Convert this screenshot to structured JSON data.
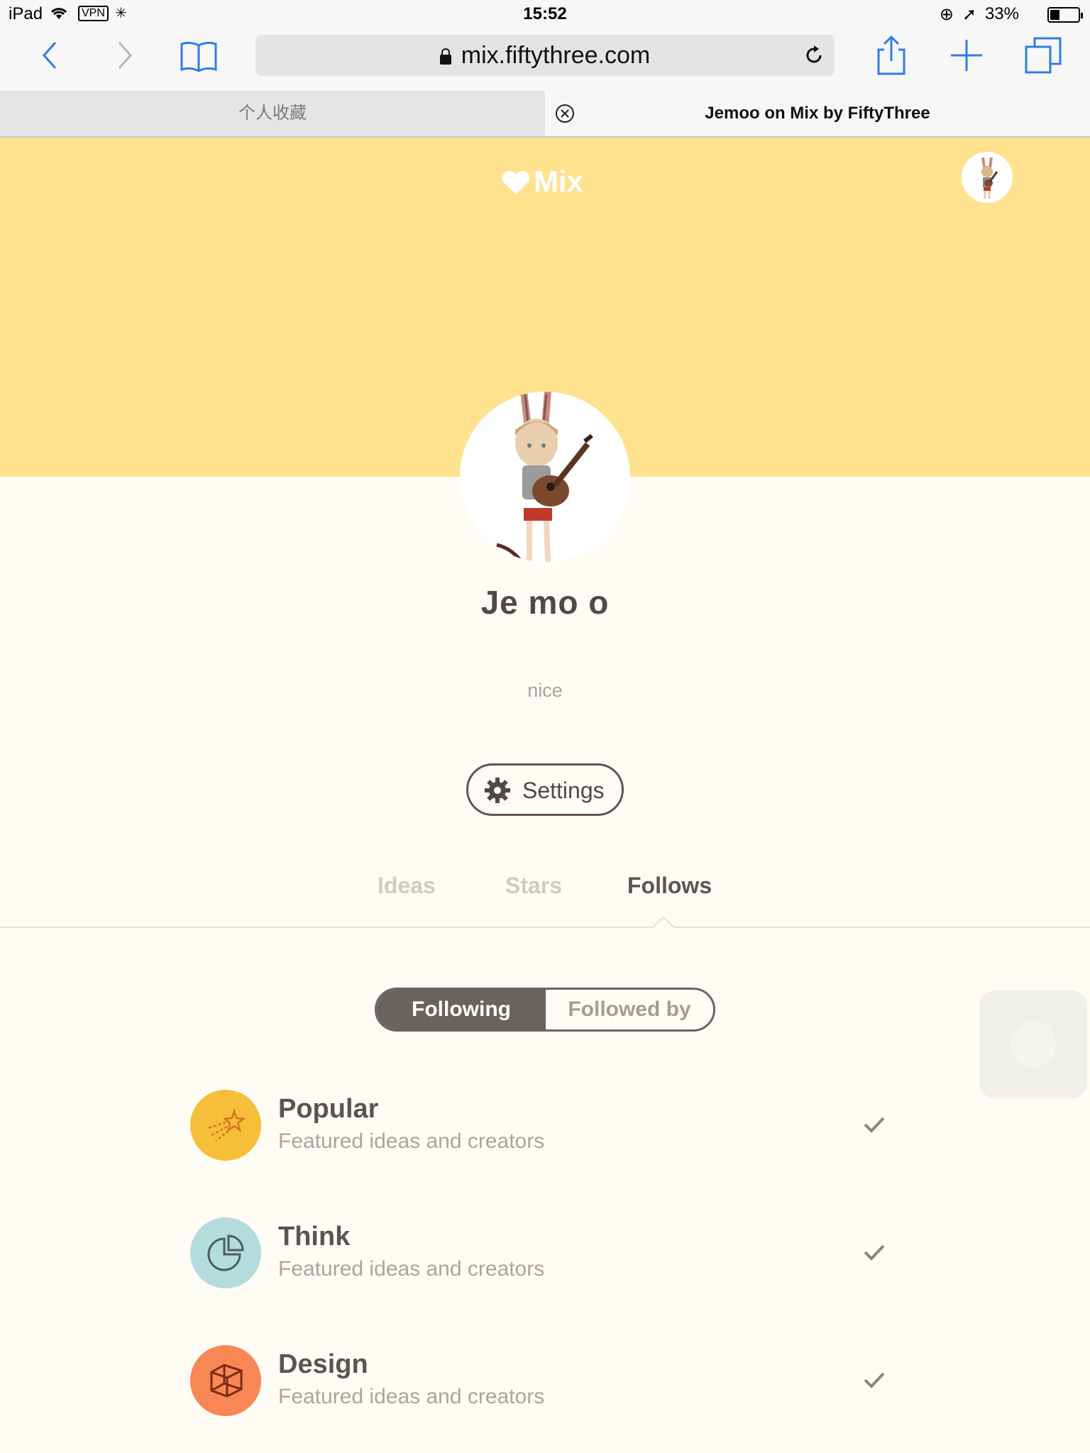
{
  "status_bar": {
    "device": "iPad",
    "vpn": "VPN",
    "time": "15:52",
    "battery_text": "33%",
    "battery_level": 0.33
  },
  "browser": {
    "url": "mix.fiftythree.com",
    "tabs": [
      {
        "title": "个人收藏",
        "active": false
      },
      {
        "title": "Jemoo on Mix by FiftyThree",
        "active": true
      }
    ]
  },
  "header": {
    "logo_text": "Mix",
    "accent_color": "#ffe28e"
  },
  "profile": {
    "name": "Je mo o",
    "bio": "nice",
    "settings_label": "Settings"
  },
  "section_tabs": [
    {
      "label": "Ideas",
      "active": false
    },
    {
      "label": "Stars",
      "active": false
    },
    {
      "label": "Follows",
      "active": true
    }
  ],
  "segment": {
    "following_label": "Following",
    "followed_by_label": "Followed by",
    "selected": "Following"
  },
  "follows_list": [
    {
      "title": "Popular",
      "subtitle": "Featured ideas and creators",
      "icon": "shooting-star-icon",
      "color": "#f6bf3a",
      "checked": true
    },
    {
      "title": "Think",
      "subtitle": "Featured ideas and creators",
      "icon": "pie-chart-icon",
      "color": "#b4dcdc",
      "checked": true
    },
    {
      "title": "Design",
      "subtitle": "Featured ideas and creators",
      "icon": "cube-icon",
      "color": "#f98655",
      "checked": true
    }
  ]
}
